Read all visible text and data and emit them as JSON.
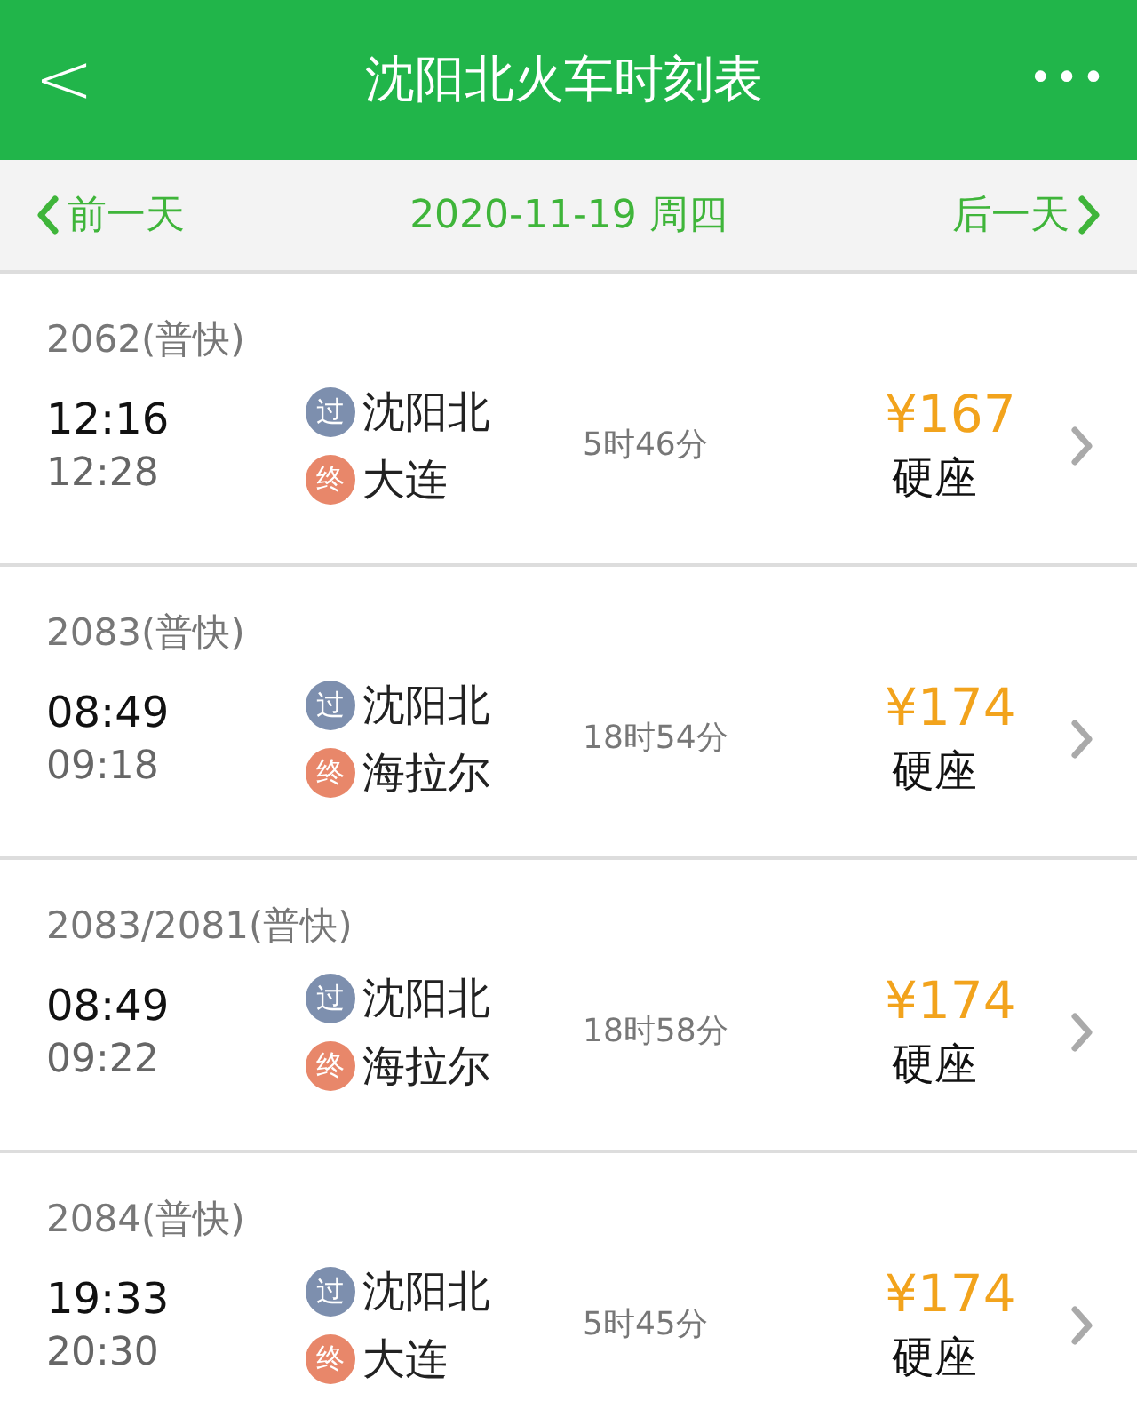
{
  "header": {
    "back": "<",
    "title": "沈阳北火车时刻表",
    "more": "•••"
  },
  "date_bar": {
    "prev": "前一天",
    "date": "2020-11-19 周四",
    "next": "后一天"
  },
  "trains": [
    {
      "number": "2062(普快)",
      "depart": "12:16",
      "arrive": "12:28",
      "stations": [
        {
          "kind": "pass",
          "badge": "过",
          "name": "沈阳北"
        },
        {
          "kind": "end",
          "badge": "终",
          "name": "大连"
        }
      ],
      "duration": "5时46分",
      "price": "¥167",
      "seat": "硬座"
    },
    {
      "number": "2083(普快)",
      "depart": "08:49",
      "arrive": "09:18",
      "stations": [
        {
          "kind": "pass",
          "badge": "过",
          "name": "沈阳北"
        },
        {
          "kind": "end",
          "badge": "终",
          "name": "海拉尔"
        }
      ],
      "duration": "18时54分",
      "price": "¥174",
      "seat": "硬座"
    },
    {
      "number": "2083/2081(普快)",
      "depart": "08:49",
      "arrive": "09:22",
      "stations": [
        {
          "kind": "pass",
          "badge": "过",
          "name": "沈阳北"
        },
        {
          "kind": "end",
          "badge": "终",
          "name": "海拉尔"
        }
      ],
      "duration": "18时58分",
      "price": "¥174",
      "seat": "硬座"
    },
    {
      "number": "2084(普快)",
      "depart": "19:33",
      "arrive": "20:30",
      "stations": [
        {
          "kind": "pass",
          "badge": "过",
          "name": "沈阳北"
        },
        {
          "kind": "end",
          "badge": "终",
          "name": "大连"
        }
      ],
      "duration": "5时45分",
      "price": "¥174",
      "seat": "硬座"
    }
  ]
}
